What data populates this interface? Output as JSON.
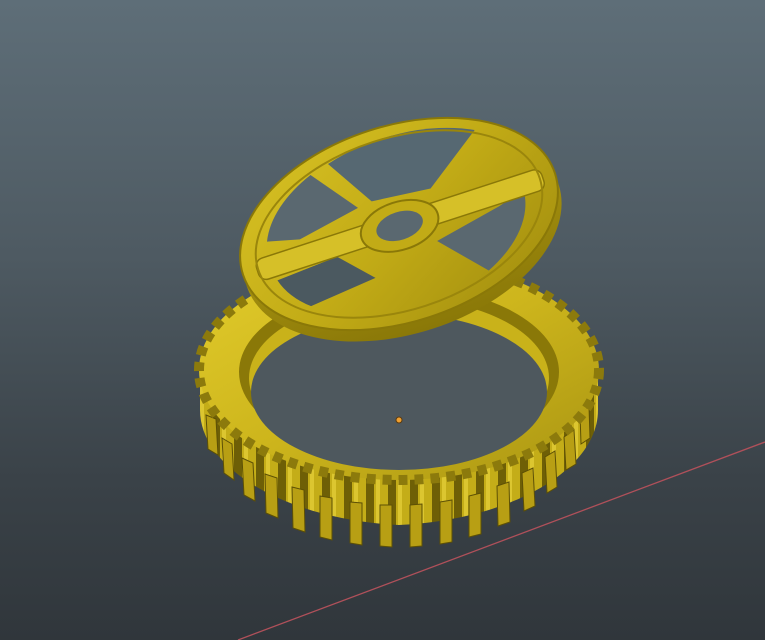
{
  "app": {
    "view": "3d-viewport",
    "background": {
      "top": "#5e6e78",
      "bottom": "#30363b"
    }
  },
  "scene": {
    "objects": [
      {
        "name": "spur-gear",
        "teeth_visible": true,
        "color": "#c9b21a"
      },
      {
        "name": "spoked-disc",
        "spokes": 4,
        "has_center_hole": true,
        "color": "#c9b21a"
      }
    ],
    "origin_marker": {
      "color": "#f0a030"
    },
    "x_axis_line": {
      "color": "#b0505a"
    }
  }
}
